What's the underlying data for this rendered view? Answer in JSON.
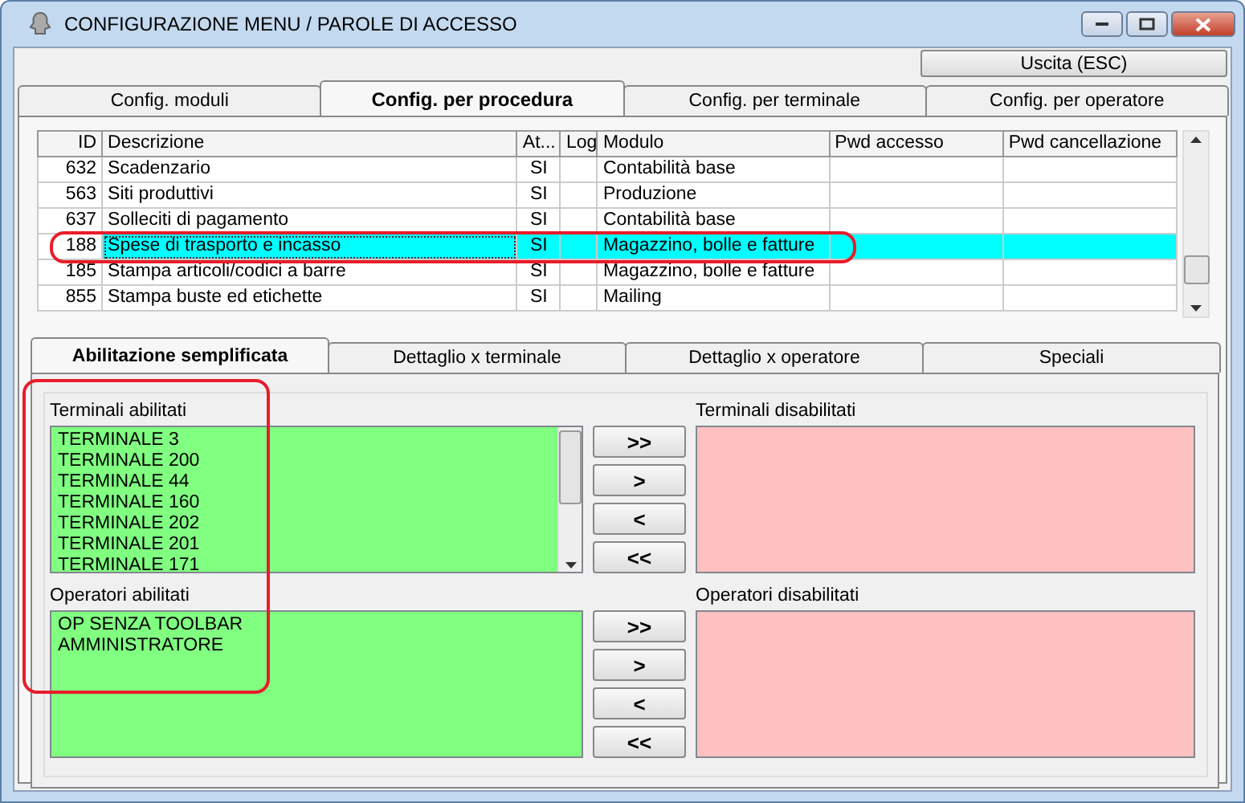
{
  "window": {
    "title": "CONFIGURAZIONE MENU / PAROLE DI ACCESSO"
  },
  "exit_button": "Uscita (ESC)",
  "tabs": [
    {
      "label": "Config. moduli",
      "selected": false
    },
    {
      "label": "Config. per procedura",
      "selected": true
    },
    {
      "label": "Config. per terminale",
      "selected": false
    },
    {
      "label": "Config. per operatore",
      "selected": false
    }
  ],
  "table": {
    "columns": [
      "ID",
      "Descrizione",
      "At...",
      "Log",
      "Modulo",
      "Pwd accesso",
      "Pwd cancellazione"
    ],
    "rows": [
      {
        "cells": [
          "632",
          "Scadenzario",
          "SI",
          "",
          "Contabilità base",
          "",
          ""
        ],
        "selected": false
      },
      {
        "cells": [
          "563",
          "Siti produttivi",
          "SI",
          "",
          "Produzione",
          "",
          ""
        ],
        "selected": false
      },
      {
        "cells": [
          "637",
          "Solleciti di pagamento",
          "SI",
          "",
          "Contabilità base",
          "",
          ""
        ],
        "selected": false
      },
      {
        "cells": [
          "188",
          "Spese di trasporto e incasso",
          "SI",
          "",
          "Magazzino, bolle e fatture",
          "",
          ""
        ],
        "selected": true
      },
      {
        "cells": [
          "185",
          "Stampa articoli/codici a barre",
          "SI",
          "",
          "Magazzino, bolle e fatture",
          "",
          ""
        ],
        "selected": false
      },
      {
        "cells": [
          "855",
          "Stampa buste ed etichette",
          "SI",
          "",
          "Mailing",
          "",
          ""
        ],
        "selected": false
      }
    ]
  },
  "subtabs": [
    {
      "label": "Abilitazione semplificata",
      "selected": true
    },
    {
      "label": "Dettaglio x terminale",
      "selected": false
    },
    {
      "label": "Dettaglio x operatore",
      "selected": false
    },
    {
      "label": "Speciali",
      "selected": false
    }
  ],
  "sections": [
    {
      "left": {
        "label": "Terminali abilitati",
        "kind": "enabled",
        "scrollbar": true,
        "items": [
          "TERMINALE 3",
          "TERMINALE 200",
          "TERMINALE 44",
          "TERMINALE 160",
          "TERMINALE 202",
          "TERMINALE 201",
          "TERMINALE 171"
        ]
      },
      "buttons": [
        ">>",
        ">",
        "<",
        "<<"
      ],
      "right": {
        "label": "Terminali disabilitati",
        "kind": "disabled",
        "scrollbar": false
      }
    },
    {
      "left": {
        "label": "Operatori abilitati",
        "kind": "enabled",
        "scrollbar": false,
        "items": [
          "OP SENZA TOOLBAR",
          "AMMINISTRATORE"
        ]
      },
      "buttons": [
        ">>",
        ">",
        "<",
        "<<"
      ],
      "right": {
        "label": "Operatori disabilitati",
        "kind": "disabled",
        "scrollbar": false
      }
    }
  ]
}
